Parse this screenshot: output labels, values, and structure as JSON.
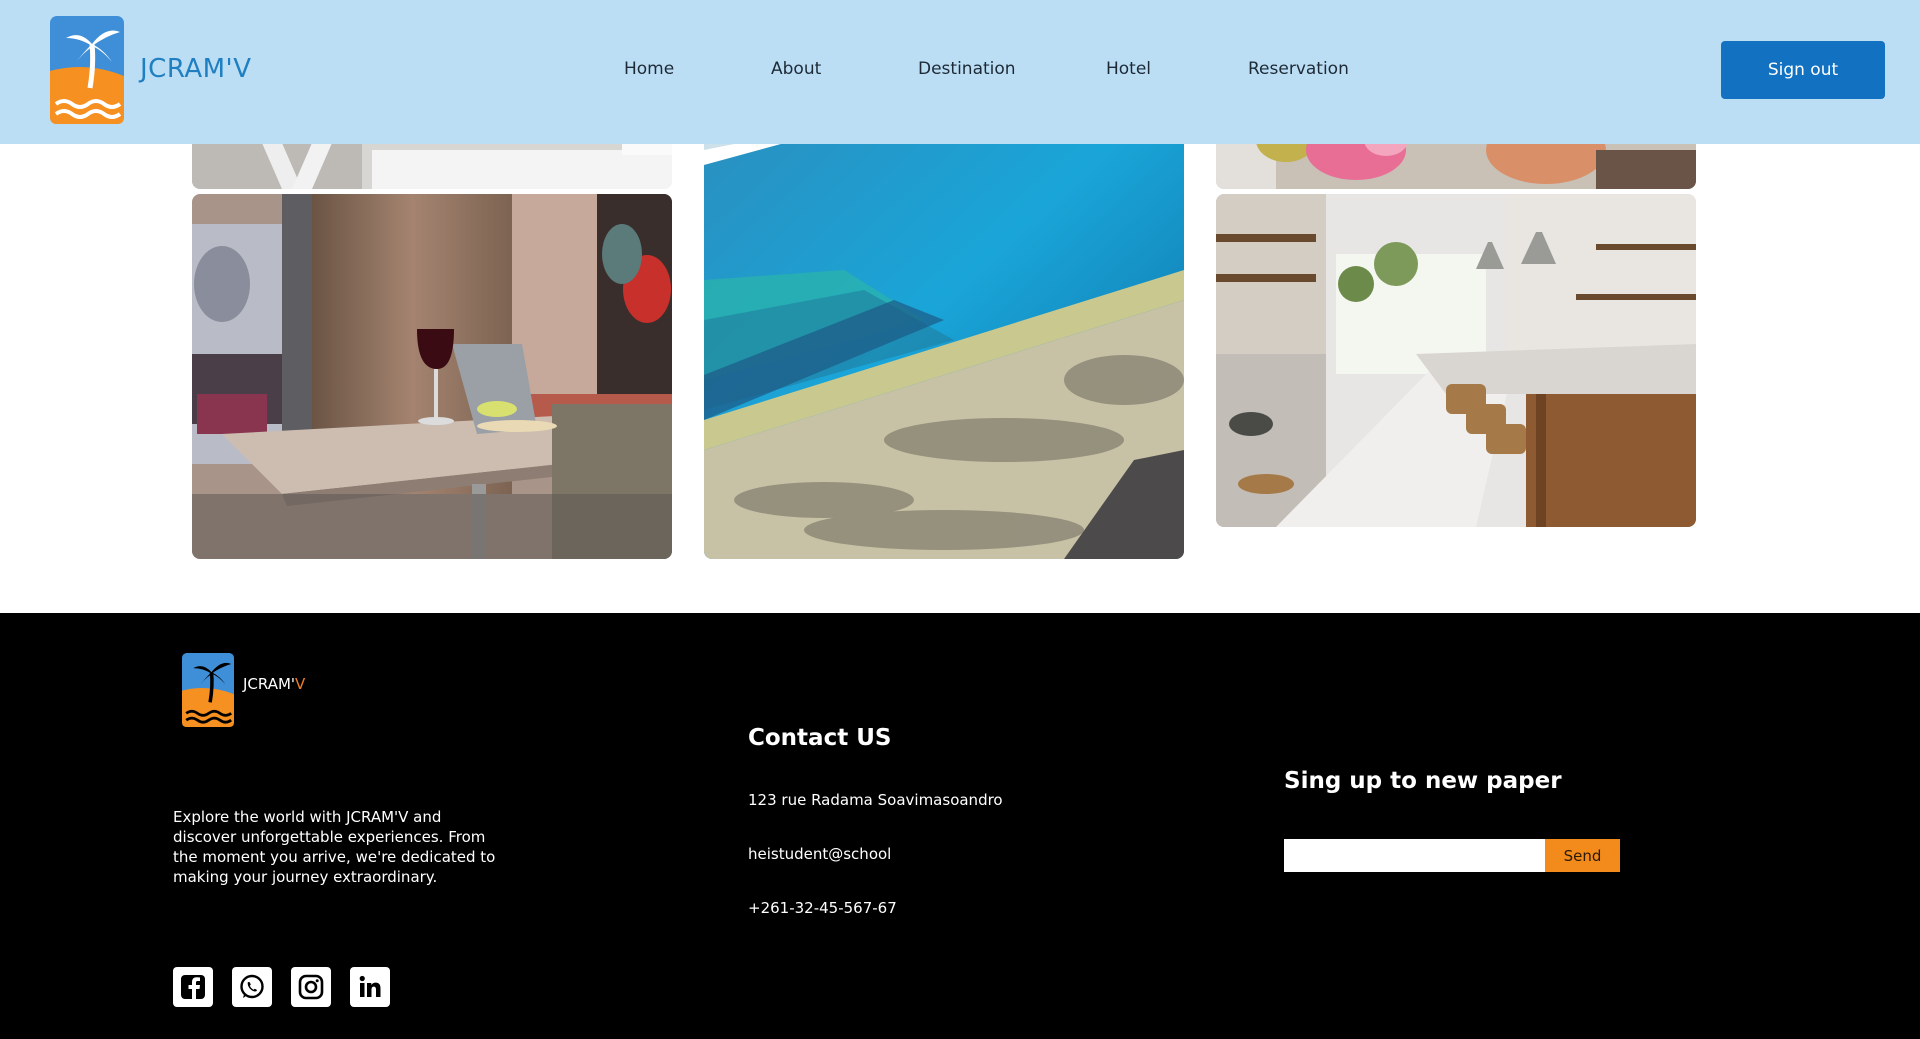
{
  "header": {
    "brand": "JCRAM'V",
    "nav": [
      "Home",
      "About",
      "Destination",
      "Hotel",
      "Reservation"
    ],
    "signout_label": "Sign out"
  },
  "gallery": {
    "images": [
      "hotel-bed-photo",
      "pool-photo",
      "flowers-photo",
      "room-table-photo",
      "kitchen-photo"
    ]
  },
  "footer": {
    "brand_main": "JCRAM'",
    "brand_accent": "V",
    "description": "Explore the world with JCRAM'V and discover unforgettable experiences. From the moment you arrive, we're dedicated to making your journey extraordinary.",
    "socials": [
      "facebook-icon",
      "whatsapp-icon",
      "instagram-icon",
      "linkedin-icon"
    ],
    "contact": {
      "title": "Contact US",
      "address": "123 rue Radama Soavimasoandro",
      "email": "heistudent@school",
      "phone": "+261-32-45-567-67"
    },
    "newsletter": {
      "title": "Sing up to new paper",
      "input_value": "",
      "send_label": "Send"
    }
  },
  "colors": {
    "header_bg": "#bcdef5",
    "brand_blue": "#1f7fc0",
    "button_blue": "#1271c1",
    "accent_orange": "#f28b1c",
    "footer_bg": "#000000"
  }
}
